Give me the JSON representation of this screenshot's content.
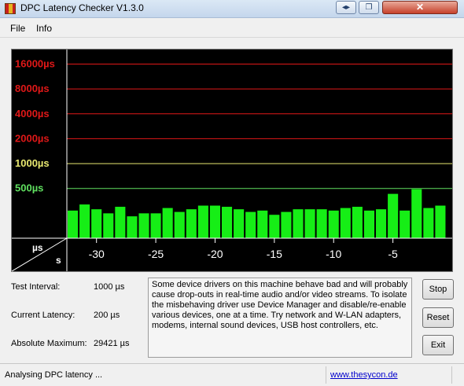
{
  "window": {
    "title": "DPC Latency Checker V1.3.0",
    "close_symbol": "✕",
    "icon": "dpc-latency-app-icon"
  },
  "menu": {
    "items": [
      "File",
      "Info"
    ]
  },
  "chart_data": {
    "type": "bar",
    "y_scale": "log",
    "y_unit": "µs",
    "x_unit": "s",
    "corner_labels": {
      "y": "µs",
      "x": "s"
    },
    "ytick_labels": [
      "16000µs",
      "8000µs",
      "4000µs",
      "2000µs",
      "1000µs",
      "500µs"
    ],
    "ytick_values": [
      16000,
      8000,
      4000,
      2000,
      1000,
      500
    ],
    "ytick_colors": [
      "#e01818",
      "#e01818",
      "#e01818",
      "#e01818",
      "#e8e870",
      "#60e060"
    ],
    "xtick_labels": [
      "-30",
      "-25",
      "-20",
      "-15",
      "-10",
      "-5"
    ],
    "xtick_values": [
      -30,
      -25,
      -20,
      -15,
      -10,
      -5
    ],
    "xlim": [
      -32.5,
      0
    ],
    "ylim": [
      125,
      24000
    ],
    "bar_color": "#16ee16",
    "x": [
      -32,
      -31,
      -30,
      -29,
      -28,
      -27,
      -26,
      -25,
      -24,
      -23,
      -22,
      -21,
      -20,
      -19,
      -18,
      -17,
      -16,
      -15,
      -14,
      -13,
      -12,
      -11,
      -10,
      -9,
      -8,
      -7,
      -6,
      -5,
      -4,
      -3,
      -2,
      -1
    ],
    "values": [
      270,
      320,
      280,
      250,
      300,
      230,
      250,
      250,
      290,
      260,
      280,
      310,
      310,
      300,
      280,
      260,
      270,
      240,
      260,
      280,
      280,
      280,
      270,
      290,
      300,
      270,
      280,
      430,
      270,
      490,
      290,
      310
    ]
  },
  "info": {
    "test_interval_label": "Test Interval:",
    "test_interval_value": "1000 µs",
    "current_latency_label": "Current Latency:",
    "current_latency_value": "200 µs",
    "absolute_maximum_label": "Absolute Maximum:",
    "absolute_maximum_value": "29421 µs"
  },
  "message": "Some device drivers on this machine behave bad and will probably\ncause drop-outs in real-time audio and/or video streams. To isolate\nthe misbehaving driver use Device Manager and disable/re-enable\nvarious devices, one at a time. Try network and W-LAN adapters,\nmodems, internal sound devices, USB host controllers, etc.",
  "buttons": {
    "stop": "Stop",
    "reset": "Reset",
    "exit": "Exit"
  },
  "status": {
    "text": "Analysing DPC latency ...",
    "link": "www.thesycon.de"
  }
}
